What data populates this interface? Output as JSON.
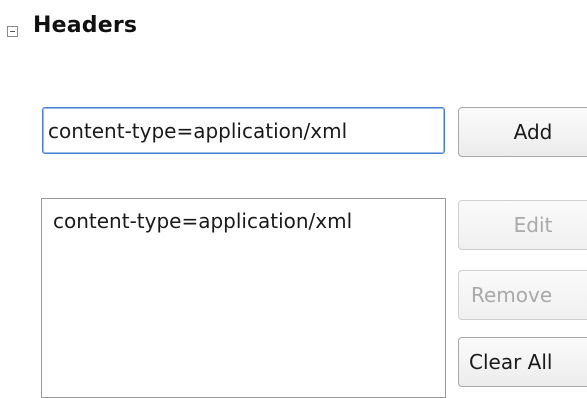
{
  "section": {
    "title": "Headers",
    "collapse_icon": "collapse-minus-icon"
  },
  "header_input": {
    "value": "content-type=application/xml",
    "placeholder": ""
  },
  "buttons": {
    "add": "Add",
    "edit": "Edit",
    "remove": "Remove",
    "clear_all": "Clear All"
  },
  "header_list": {
    "items": [
      {
        "label": "content-type=application/xml"
      }
    ]
  },
  "colors": {
    "focus_border": "#4a7fd4",
    "disabled_text": "#a9a9a9"
  }
}
